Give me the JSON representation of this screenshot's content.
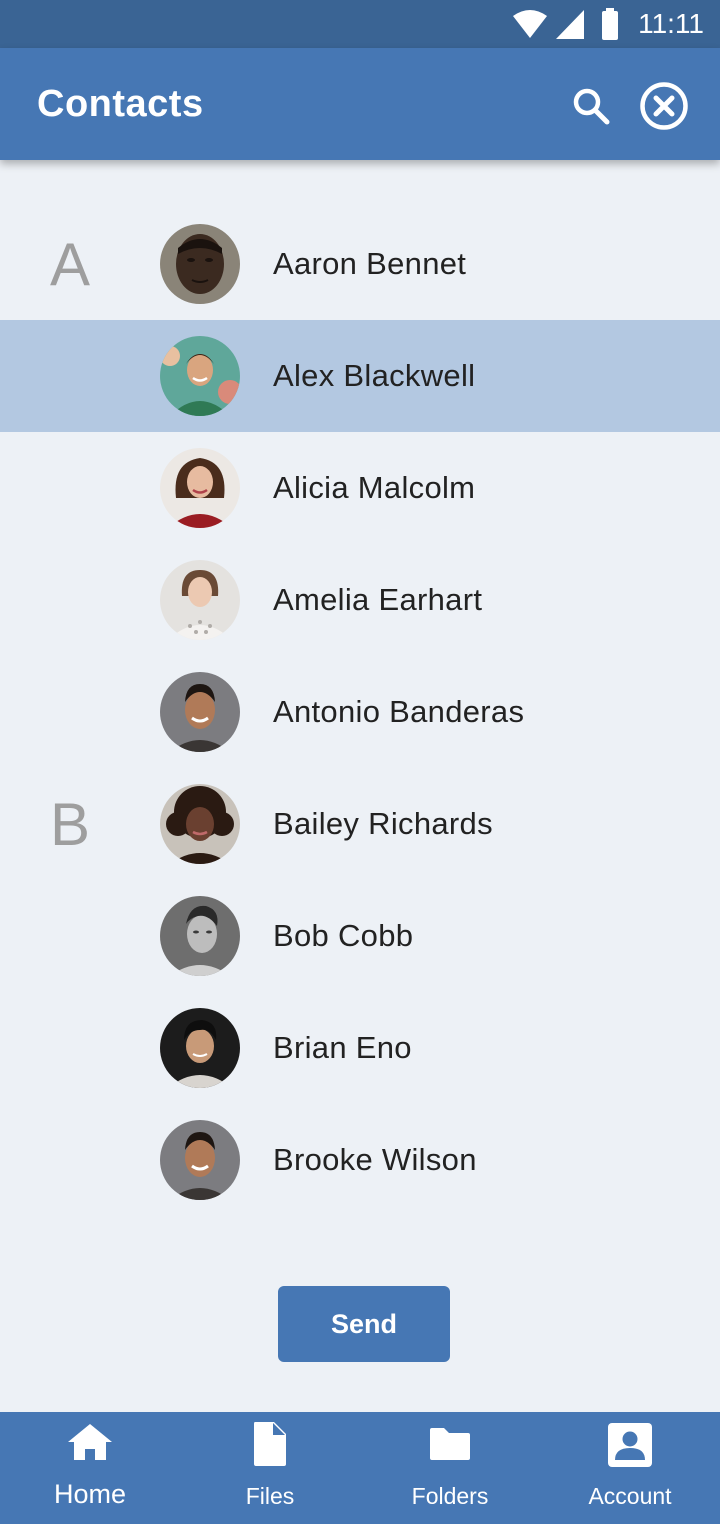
{
  "status_bar": {
    "time": "11:11",
    "icons": [
      "wifi-icon",
      "cell-signal-icon",
      "battery-icon"
    ]
  },
  "app_bar": {
    "title": "Contacts",
    "actions": [
      "search-icon",
      "close-circle-icon"
    ]
  },
  "contacts": [
    {
      "section": "A",
      "name": "Aaron Bennet",
      "selected": false
    },
    {
      "section": "",
      "name": "Alex Blackwell",
      "selected": true
    },
    {
      "section": "",
      "name": "Alicia Malcolm",
      "selected": false
    },
    {
      "section": "",
      "name": "Amelia Earhart",
      "selected": false
    },
    {
      "section": "",
      "name": "Antonio Banderas",
      "selected": false
    },
    {
      "section": "B",
      "name": "Bailey Richards",
      "selected": false
    },
    {
      "section": "",
      "name": "Bob Cobb",
      "selected": false
    },
    {
      "section": "",
      "name": "Brian Eno",
      "selected": false
    },
    {
      "section": "",
      "name": "Brooke Wilson",
      "selected": false
    }
  ],
  "send_button": {
    "label": "Send"
  },
  "bottom_nav": [
    {
      "label": "Home",
      "icon": "home-icon",
      "active": true
    },
    {
      "label": "Files",
      "icon": "file-icon",
      "active": false
    },
    {
      "label": "Folders",
      "icon": "folder-icon",
      "active": false
    },
    {
      "label": "Account",
      "icon": "account-icon",
      "active": false
    }
  ],
  "colors": {
    "primary": "#4677b4",
    "status_bar": "#3a6494",
    "background": "#edf1f6",
    "selected_row": "#b3c8e1"
  }
}
